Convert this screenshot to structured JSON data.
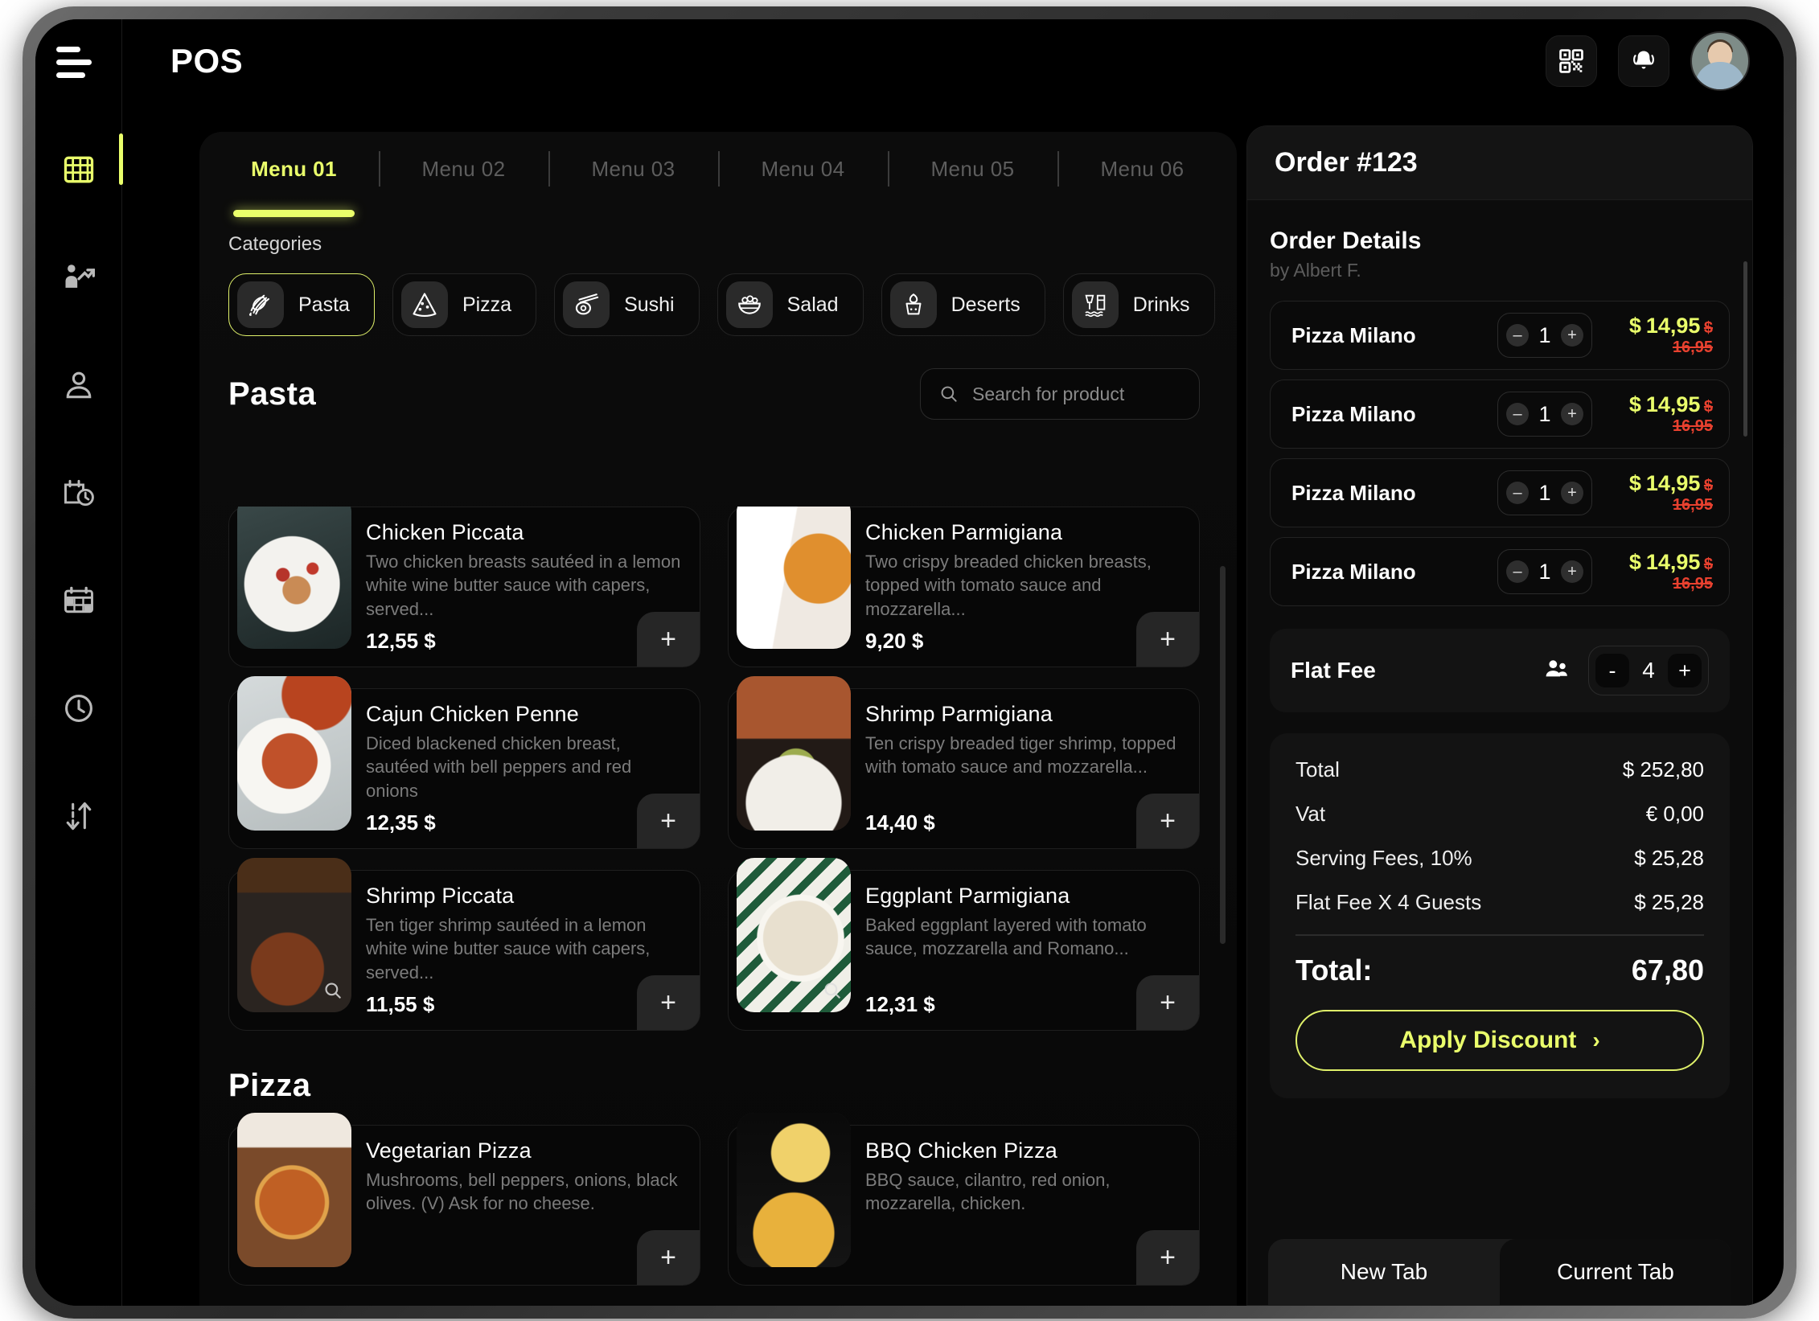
{
  "app": {
    "title": "POS"
  },
  "topbar": {
    "qr_icon": "qr-code-icon",
    "bell_icon": "notification-bell-icon",
    "avatar": "user-avatar"
  },
  "sidebar": {
    "items": [
      {
        "icon": "grid-menu-icon",
        "active": true
      },
      {
        "icon": "analytics-icon",
        "active": false
      },
      {
        "icon": "person-icon",
        "active": false
      },
      {
        "icon": "schedule-clock-icon",
        "active": false
      },
      {
        "icon": "calendar-icon",
        "active": false
      },
      {
        "icon": "clock-icon",
        "active": false
      },
      {
        "icon": "transfer-arrows-icon",
        "active": false
      }
    ]
  },
  "menu_tabs": [
    {
      "label": "Menu 01",
      "active": true
    },
    {
      "label": "Menu 02",
      "active": false
    },
    {
      "label": "Menu 03",
      "active": false
    },
    {
      "label": "Menu 04",
      "active": false
    },
    {
      "label": "Menu 05",
      "active": false
    },
    {
      "label": "Menu 06",
      "active": false
    }
  ],
  "categories": {
    "label": "Categories",
    "items": [
      {
        "label": "Pasta",
        "icon": "pasta-icon",
        "active": true
      },
      {
        "label": "Pizza",
        "icon": "pizza-slice-icon",
        "active": false
      },
      {
        "label": "Sushi",
        "icon": "sushi-icon",
        "active": false
      },
      {
        "label": "Salad",
        "icon": "salad-bowl-icon",
        "active": false
      },
      {
        "label": "Deserts",
        "icon": "cupcake-icon",
        "active": false
      },
      {
        "label": "Drinks",
        "icon": "drinks-icon",
        "active": false
      }
    ]
  },
  "search": {
    "placeholder": "Search for product",
    "value": "",
    "icon": "search-icon"
  },
  "sections": [
    {
      "title": "Pasta",
      "products": [
        {
          "name": "Chicken Piccata",
          "desc": "Two chicken breasts sautéed in a lemon white wine butter sauce with capers, served...",
          "price": "12,55 $",
          "add": "+"
        },
        {
          "name": "Chicken Parmigiana",
          "desc": "Two crispy breaded chicken breasts, topped with tomato sauce and mozzarella...",
          "price": "9,20  $",
          "add": "+"
        },
        {
          "name": "Cajun Chicken Penne",
          "desc": "Diced blackened chicken breast, sautéed with bell peppers and red onions",
          "price": "12,35 $",
          "add": "+"
        },
        {
          "name": "Shrimp Parmigiana",
          "desc": "Ten crispy breaded tiger shrimp, topped with tomato sauce and mozzarella...",
          "price": "14,40 $",
          "add": "+"
        },
        {
          "name": "Shrimp Piccata",
          "desc": "Ten tiger shrimp sautéed in a lemon white wine butter sauce with capers, served...",
          "price": "11,55  $",
          "add": "+"
        },
        {
          "name": "Eggplant Parmigiana",
          "desc": "Baked eggplant layered with tomato sauce,  mozzarella and Romano...",
          "price": "12,31  $",
          "add": "+"
        }
      ]
    },
    {
      "title": "Pizza",
      "products": [
        {
          "name": "Vegetarian Pizza",
          "desc": "Mushrooms, bell peppers, onions, black olives. (V) Ask for no cheese.",
          "price": "",
          "add": "+"
        },
        {
          "name": "BBQ Chicken Pizza",
          "desc": "BBQ sauce, cilantro, red onion, mozzarella, chicken.",
          "price": "",
          "add": "+"
        }
      ]
    }
  ],
  "order": {
    "number": "Order #123",
    "details_title": "Order Details",
    "author": "by Albert F.",
    "items": [
      {
        "name": "Pizza Milano",
        "qty": "1",
        "currency": "$",
        "price": "14,95",
        "old_price": "$ 16,95"
      },
      {
        "name": "Pizza Milano",
        "qty": "1",
        "currency": "$",
        "price": "14,95",
        "old_price": "$ 16,95"
      },
      {
        "name": "Pizza Milano",
        "qty": "1",
        "currency": "$",
        "price": "14,95",
        "old_price": "$ 16,95"
      },
      {
        "name": "Pizza Milano",
        "qty": "1",
        "currency": "$",
        "price": "14,95",
        "old_price": "$ 16,95"
      }
    ],
    "flat_fee": {
      "label": "Flat Fee",
      "guests": "4",
      "minus": "-",
      "plus": "+",
      "icon": "guests-icon"
    },
    "summary": [
      {
        "label": "Total",
        "value": "$ 252,80"
      },
      {
        "label": "Vat",
        "value": "€ 0,00"
      },
      {
        "label": "Serving Fees, 10%",
        "value": "$ 25,28"
      },
      {
        "label": "Flat Fee X 4 Guests",
        "value": "$ 25,28"
      }
    ],
    "grand_total": {
      "label": "Total:",
      "value": "67,80"
    },
    "apply_discount": {
      "label": "Apply Discount",
      "chevron": "›"
    },
    "tabs": [
      {
        "label": "New Tab",
        "active": false
      },
      {
        "label": "Current Tab",
        "active": true
      }
    ]
  },
  "colors": {
    "accent": "#eaff6b",
    "accent_border": "#dff06a",
    "danger": "#e8412f",
    "bg": "#000000",
    "panel": "#0c0c0c"
  }
}
